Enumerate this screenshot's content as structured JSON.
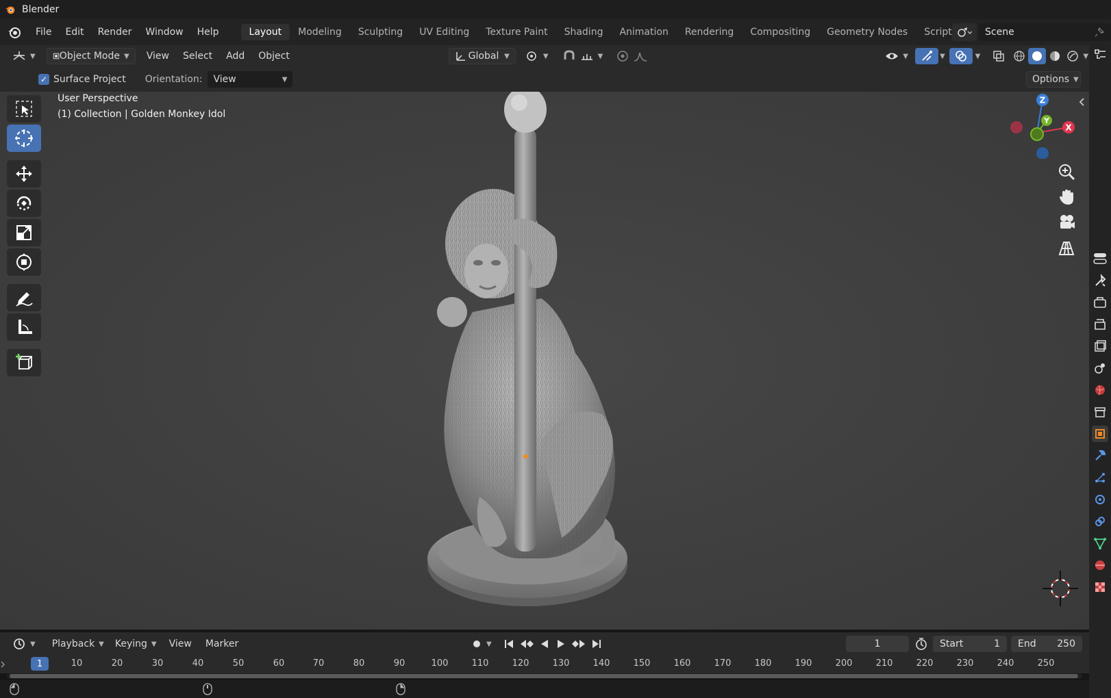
{
  "window": {
    "title": "Blender"
  },
  "menu": {
    "items": [
      "File",
      "Edit",
      "Render",
      "Window",
      "Help"
    ]
  },
  "workspaces": {
    "tabs": [
      "Layout",
      "Modeling",
      "Sculpting",
      "UV Editing",
      "Texture Paint",
      "Shading",
      "Animation",
      "Rendering",
      "Compositing",
      "Geometry Nodes",
      "Scripting"
    ],
    "active": "Layout",
    "add_label": "+"
  },
  "scene": {
    "name": "Scene"
  },
  "viewport_header": {
    "mode": "Object Mode",
    "menus": [
      "View",
      "Select",
      "Add",
      "Object"
    ],
    "transform_orientation": "Global"
  },
  "tool_settings": {
    "surface_project_label": "Surface Project",
    "surface_project_checked": true,
    "orientation_label": "Orientation:",
    "orientation_value": "View",
    "options_label": "Options"
  },
  "viewport": {
    "perspective_label": "User Perspective",
    "collection_label": "(1) Collection | Golden Monkey Idol",
    "gizmo_axes": [
      "Z",
      "Y",
      "X"
    ]
  },
  "timeline": {
    "menus": [
      "Playback",
      "Keying",
      "View",
      "Marker"
    ],
    "current_frame": "1",
    "start_label": "Start",
    "start_value": "1",
    "end_label": "End",
    "end_value": "250",
    "ruler_current": "1",
    "ruler_ticks": [
      "10",
      "20",
      "30",
      "40",
      "50",
      "60",
      "70",
      "80",
      "90",
      "100",
      "110",
      "120",
      "130",
      "140",
      "150",
      "160",
      "170",
      "180",
      "190",
      "200",
      "210",
      "220",
      "230",
      "240",
      "250"
    ]
  },
  "icons": {
    "colors": {
      "accent": "#4772b3",
      "x_axis": "#e0374f",
      "y_axis": "#76b82a",
      "z_axis": "#3b7fd9",
      "origin": "#ff8c00"
    }
  }
}
